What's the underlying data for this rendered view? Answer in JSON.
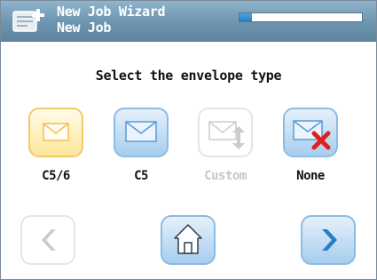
{
  "header": {
    "title": "New Job Wizard",
    "subtitle": "New Job",
    "icon": "new-job-icon",
    "progress_fraction": 0.1
  },
  "prompt": "Select the envelope type",
  "options": [
    {
      "label": "C5/6",
      "icon": "envelope-icon",
      "state": "selected"
    },
    {
      "label": "C5",
      "icon": "envelope-icon",
      "state": "enabled"
    },
    {
      "label": "Custom",
      "icon": "envelope-resize-icon",
      "state": "disabled"
    },
    {
      "label": "None",
      "icon": "envelope-none-icon",
      "state": "enabled"
    }
  ],
  "navigation": {
    "back": {
      "icon": "chevron-left-icon",
      "state": "disabled"
    },
    "home": {
      "icon": "home-icon",
      "state": "enabled"
    },
    "next": {
      "icon": "chevron-right-icon",
      "state": "enabled"
    }
  },
  "colors": {
    "header": "#6f96b0",
    "selected_tile": "#fde79a",
    "tile": "#a7cdee",
    "accent": "#2a7fc4",
    "none_cross": "#e02020"
  }
}
